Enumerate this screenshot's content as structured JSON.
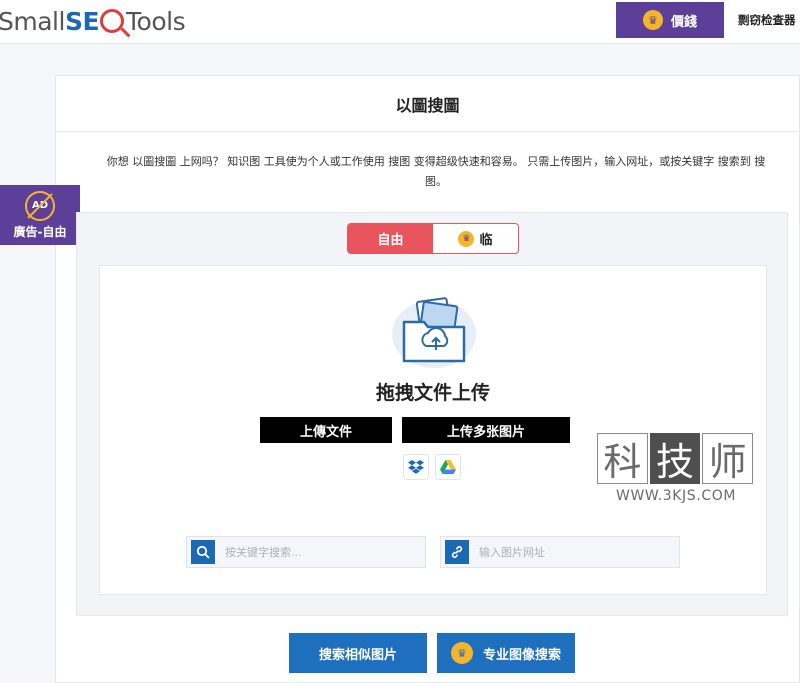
{
  "header": {
    "logo": {
      "part1": "Small",
      "part2": "SE",
      "part3": "Tools"
    },
    "premium_label": "價錢",
    "nav_link": "剽窃检查器"
  },
  "ad_badge": {
    "icon_text": "AD",
    "label": "廣告-自由"
  },
  "main": {
    "title": "以圖搜圖",
    "description": "你想 以圖搜圖 上网吗？ 知识图 工具使为个人或工作使用 搜图 变得超级快速和容易。 只需上传图片，输入网址，或按关键字 搜索到 搜图。"
  },
  "toggle": {
    "free_label": "自由",
    "pro_label": "临"
  },
  "upload": {
    "title": "拖拽文件上传",
    "upload_file_label": "上傳文件",
    "upload_multi_label": "上传多张图片"
  },
  "search": {
    "keyword_placeholder": "按关键字搜索...",
    "url_placeholder": "输入图片网址"
  },
  "watermark": {
    "chars": [
      "科",
      "技",
      "师"
    ],
    "url": "WWW.3KJS.COM"
  },
  "buttons": {
    "similar_label": "搜索相似图片",
    "pro_search_label": "专业图像搜索"
  },
  "colors": {
    "brand_purple": "#5b3f99",
    "brand_blue": "#1e6fbd",
    "toggle_red": "#e8545d",
    "crown_gold": "#f5b52a"
  },
  "icons": [
    "crown-icon",
    "ad-block-icon",
    "folder-upload-icon",
    "dropbox-icon",
    "google-drive-icon",
    "search-icon",
    "link-icon"
  ]
}
